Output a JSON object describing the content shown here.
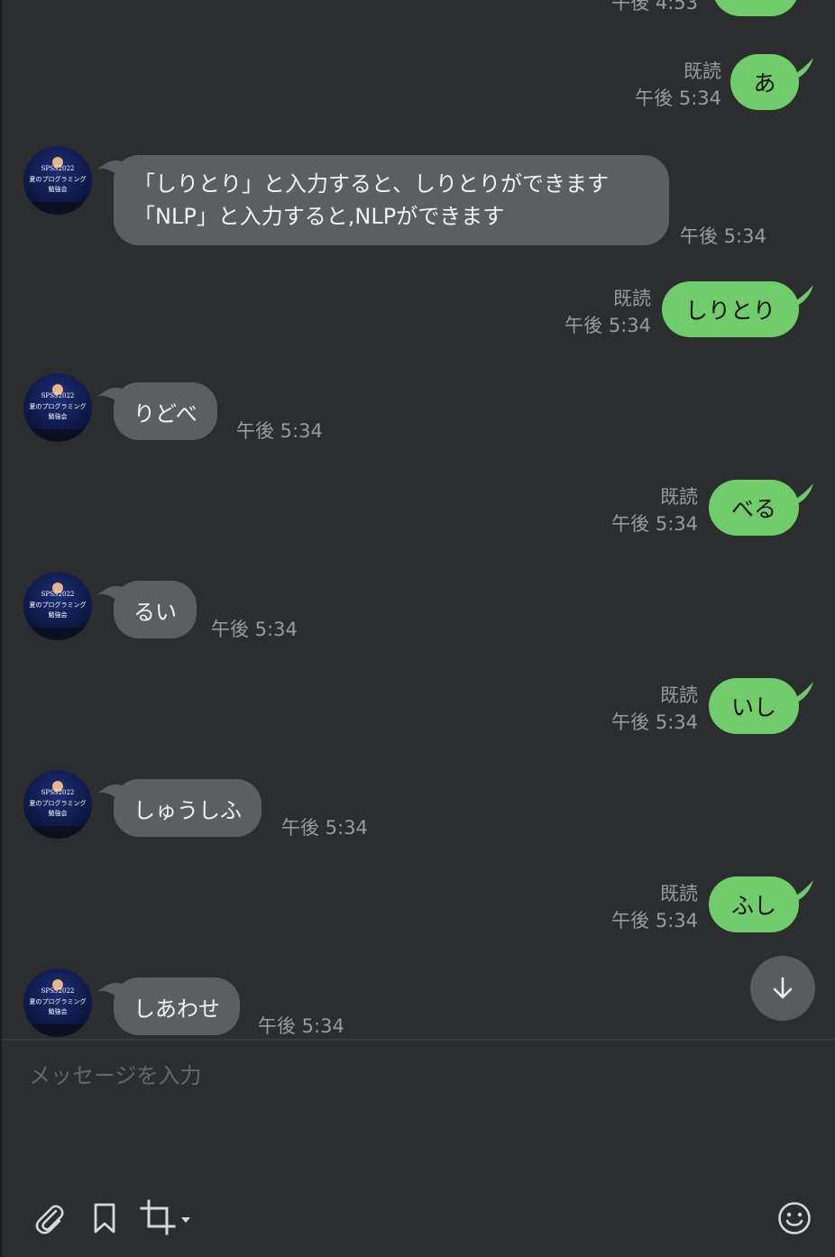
{
  "colors": {
    "background": "#2c2d2f",
    "outgoing_bubble": "#71cc6b",
    "incoming_bubble": "#5d5e60",
    "meta_text": "#9a9b9d"
  },
  "top_partial": {
    "time": "午後 4:53"
  },
  "messages": [
    {
      "direction": "out",
      "text": "あ",
      "read": "既読",
      "time": "午後 5:34"
    },
    {
      "direction": "in",
      "lines": [
        "「しりとり」と入力すると、しりとりができます",
        "「NLP」と入力すると,NLPができます"
      ],
      "time": "午後 5:34"
    },
    {
      "direction": "out",
      "text": "しりとり",
      "read": "既読",
      "time": "午後 5:34"
    },
    {
      "direction": "in",
      "text": "りどべ",
      "time": "午後 5:34"
    },
    {
      "direction": "out",
      "text": "べる",
      "read": "既読",
      "time": "午後 5:34"
    },
    {
      "direction": "in",
      "text": "るい",
      "time": "午後 5:34"
    },
    {
      "direction": "out",
      "text": "いし",
      "read": "既読",
      "time": "午後 5:34"
    },
    {
      "direction": "in",
      "text": "しゅうしふ",
      "time": "午後 5:34"
    },
    {
      "direction": "out",
      "text": "ふし",
      "read": "既読",
      "time": "午後 5:34"
    },
    {
      "direction": "in",
      "text": "しあわせ",
      "time": "午後 5:34"
    }
  ],
  "avatar": {
    "line1": "SPSS2022",
    "line2": "夏のプログラミング",
    "line3": "勉強会"
  },
  "composer": {
    "placeholder": "メッセージを入力",
    "value": ""
  },
  "icons": {
    "scroll_down": "arrow-down-icon",
    "attach": "paperclip-icon",
    "keep": "bookmark-icon",
    "capture": "crop-icon",
    "emoji": "smiley-icon"
  }
}
